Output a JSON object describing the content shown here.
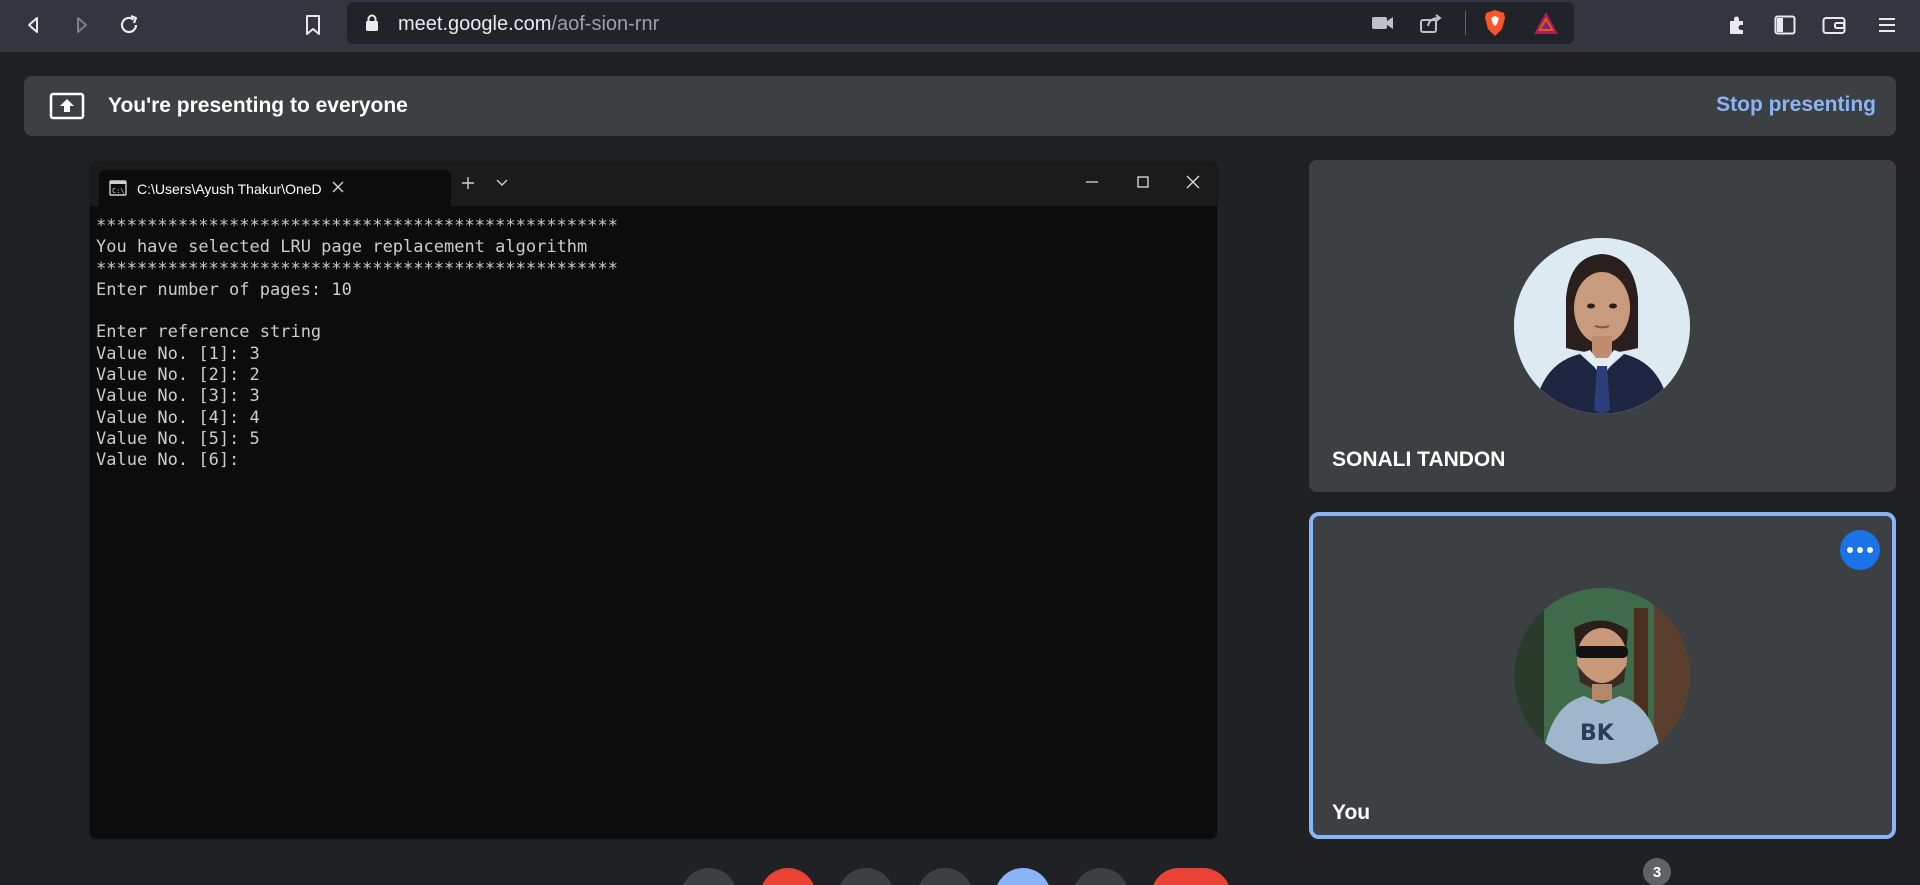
{
  "browser": {
    "url_host": "meet.google.com",
    "url_path": "/aof-sion-rnr"
  },
  "banner": {
    "text": "You're presenting to everyone",
    "stop_label": "Stop presenting"
  },
  "terminal": {
    "tab_title": "C:\\Users\\Ayush Thakur\\OneD",
    "lines": [
      "***************************************************",
      "You have selected LRU page replacement algorithm",
      "***************************************************",
      "Enter number of pages: 10",
      "",
      "Enter reference string",
      "Value No. [1]: 3",
      "Value No. [2]: 2",
      "Value No. [3]: 3",
      "Value No. [4]: 4",
      "Value No. [5]: 5",
      "Value No. [6]: "
    ]
  },
  "participants": [
    {
      "name": "SONALI TANDON"
    },
    {
      "name": "You"
    }
  ],
  "participant_count": "3",
  "colors": {
    "accent_blue": "#8ab4f8",
    "more_button": "#1a73e8",
    "end_call_red": "#ea4335"
  }
}
